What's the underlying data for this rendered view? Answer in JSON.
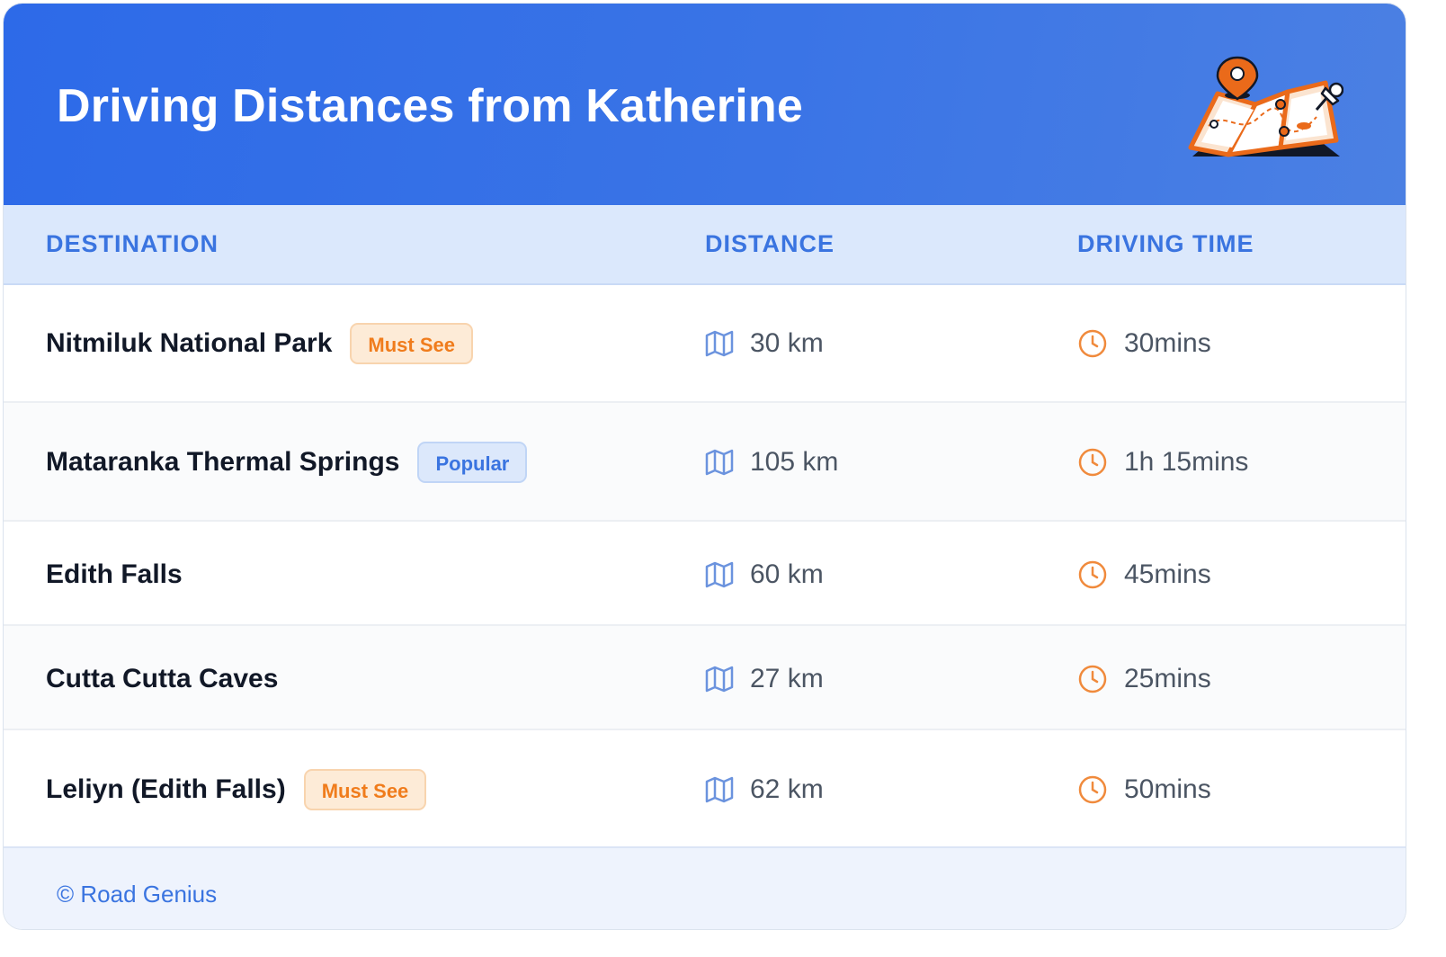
{
  "header": {
    "title": "Driving Distances from Katherine",
    "illustration_icon": "map-with-pins-icon"
  },
  "columns": {
    "destination": "DESTINATION",
    "distance": "DISTANCE",
    "driving_time": "DRIVING TIME"
  },
  "rows": [
    {
      "destination": "Nitmiluk National Park",
      "badge": "Must See",
      "badge_type": "must-see",
      "distance": "30 km",
      "time": "30mins"
    },
    {
      "destination": "Mataranka Thermal Springs",
      "badge": "Popular",
      "badge_type": "popular",
      "distance": "105 km",
      "time": "1h 15mins"
    },
    {
      "destination": "Edith Falls",
      "badge": "",
      "badge_type": "",
      "distance": "60 km",
      "time": "45mins"
    },
    {
      "destination": "Cutta Cutta Caves",
      "badge": "",
      "badge_type": "",
      "distance": "27 km",
      "time": "25mins"
    },
    {
      "destination": "Leliyn (Edith Falls)",
      "badge": "Must See",
      "badge_type": "must-see",
      "distance": "62 km",
      "time": "50mins"
    }
  ],
  "icons": {
    "distance": "map-icon",
    "time": "clock-icon"
  },
  "colors": {
    "header_start": "#2d6ae8",
    "header_end": "#4b80e3",
    "accent_blue": "#3a74e0",
    "accent_orange": "#f07c1c"
  },
  "footer": {
    "copyright": "© Road Genius"
  }
}
